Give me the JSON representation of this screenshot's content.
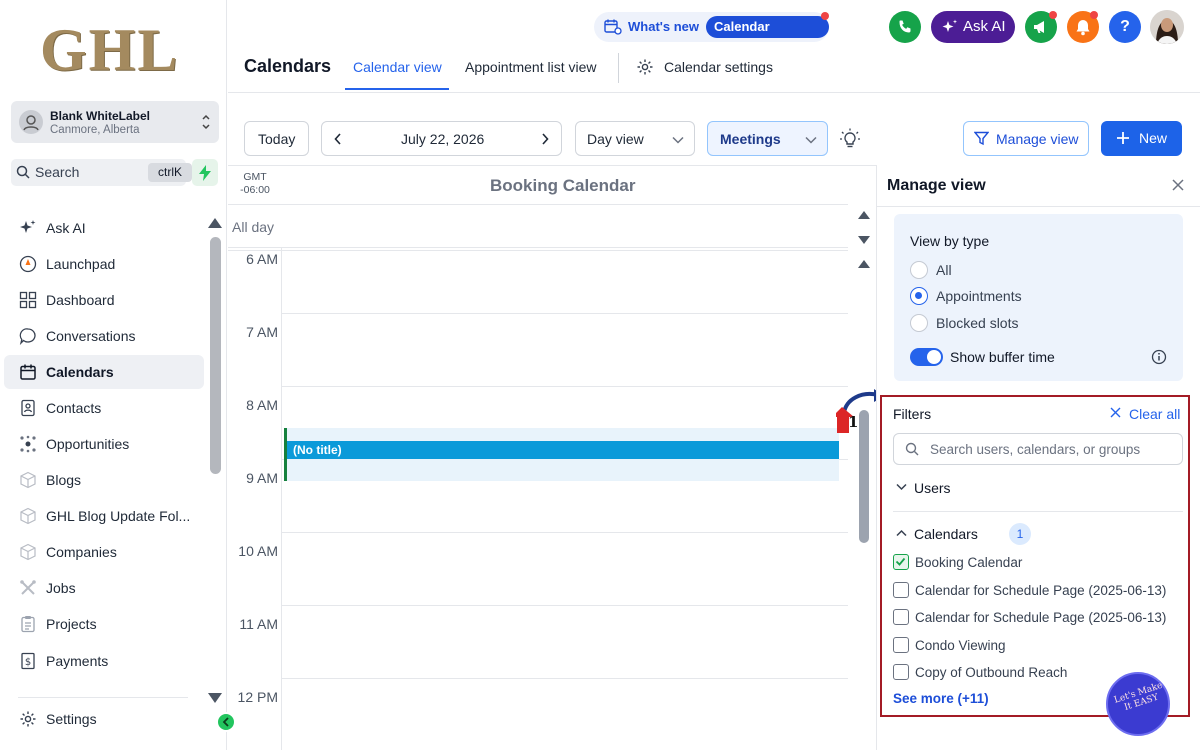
{
  "sidebar": {
    "logo_text": "GHL",
    "account": {
      "name": "Blank WhiteLabel",
      "location": "Canmore, Alberta"
    },
    "search": {
      "placeholder": "Search",
      "shortcut": "ctrlK"
    },
    "items": [
      {
        "label": "Ask AI",
        "icon": "sparkle-icon"
      },
      {
        "label": "Launchpad",
        "icon": "rocket-icon"
      },
      {
        "label": "Dashboard",
        "icon": "dashboard-grid-icon"
      },
      {
        "label": "Conversations",
        "icon": "chat-bubble-icon"
      },
      {
        "label": "Calendars",
        "icon": "calendar-icon",
        "active": true
      },
      {
        "label": "Contacts",
        "icon": "contacts-icon"
      },
      {
        "label": "Opportunities",
        "icon": "opportunities-icon"
      },
      {
        "label": "Blogs",
        "icon": "cube-icon"
      },
      {
        "label": "GHL Blog Update Fol...",
        "icon": "cube-icon"
      },
      {
        "label": "Companies",
        "icon": "cube-icon"
      },
      {
        "label": "Jobs",
        "icon": "tools-icon"
      },
      {
        "label": "Projects",
        "icon": "clipboard-icon"
      },
      {
        "label": "Payments",
        "icon": "dollar-receipt-icon"
      }
    ],
    "settings_label": "Settings"
  },
  "header": {
    "whats_new": "What's new",
    "calendar_updates": "Calendar updates",
    "ask_ai": "Ask AI",
    "help": "?",
    "title": "Calendars",
    "tabs": [
      {
        "label": "Calendar view",
        "active": true
      },
      {
        "label": "Appointment list view"
      },
      {
        "label": "Calendar settings"
      }
    ]
  },
  "toolbar": {
    "today": "Today",
    "date": "July 22, 2026",
    "view_mode": "Day view",
    "calendar_select": "Meetings",
    "manage_view": "Manage view",
    "new": "New"
  },
  "calendar": {
    "timezone_line1": "GMT",
    "timezone_line2": "-06:00",
    "title": "Booking Calendar",
    "all_day": "All day",
    "hours": [
      "6 AM",
      "7 AM",
      "8 AM",
      "9 AM",
      "10 AM",
      "11 AM",
      "12 PM"
    ],
    "event": {
      "title": "(No title)"
    }
  },
  "manage_view": {
    "title": "Manage view",
    "view_by_type": "View by type",
    "options": [
      {
        "label": "All",
        "selected": false
      },
      {
        "label": "Appointments",
        "selected": true
      },
      {
        "label": "Blocked slots",
        "selected": false
      }
    ],
    "show_buffer_time": {
      "label": "Show buffer time",
      "on": true
    },
    "filters": {
      "title": "Filters",
      "clear_all": "Clear all",
      "search_placeholder": "Search users, calendars, or groups",
      "users_label": "Users",
      "calendars_label": "Calendars",
      "calendars_count": "1",
      "calendar_items": [
        {
          "label": "Booking Calendar",
          "checked": true
        },
        {
          "label": "Calendar for Schedule Page (2025-06-13)",
          "checked": false
        },
        {
          "label": "Calendar for Schedule Page (2025-06-13)",
          "checked": false
        },
        {
          "label": "Condo Viewing",
          "checked": false
        },
        {
          "label": "Copy of Outbound Reach",
          "checked": false
        }
      ],
      "see_more": "See more (+11)"
    }
  },
  "annotation": {
    "step_number": "1"
  },
  "watermark_text": "Let's Make It EASY",
  "colors": {
    "primary": "#1d63e8",
    "ask_ai_bg": "#4c1d95",
    "event_bar": "#0b9ad9",
    "highlight_box": "#a31b25",
    "phone_btn": "#16a34a",
    "megaphone_btn": "#16a34a",
    "bell_btn": "#f97316",
    "help_btn": "#2563eb"
  }
}
